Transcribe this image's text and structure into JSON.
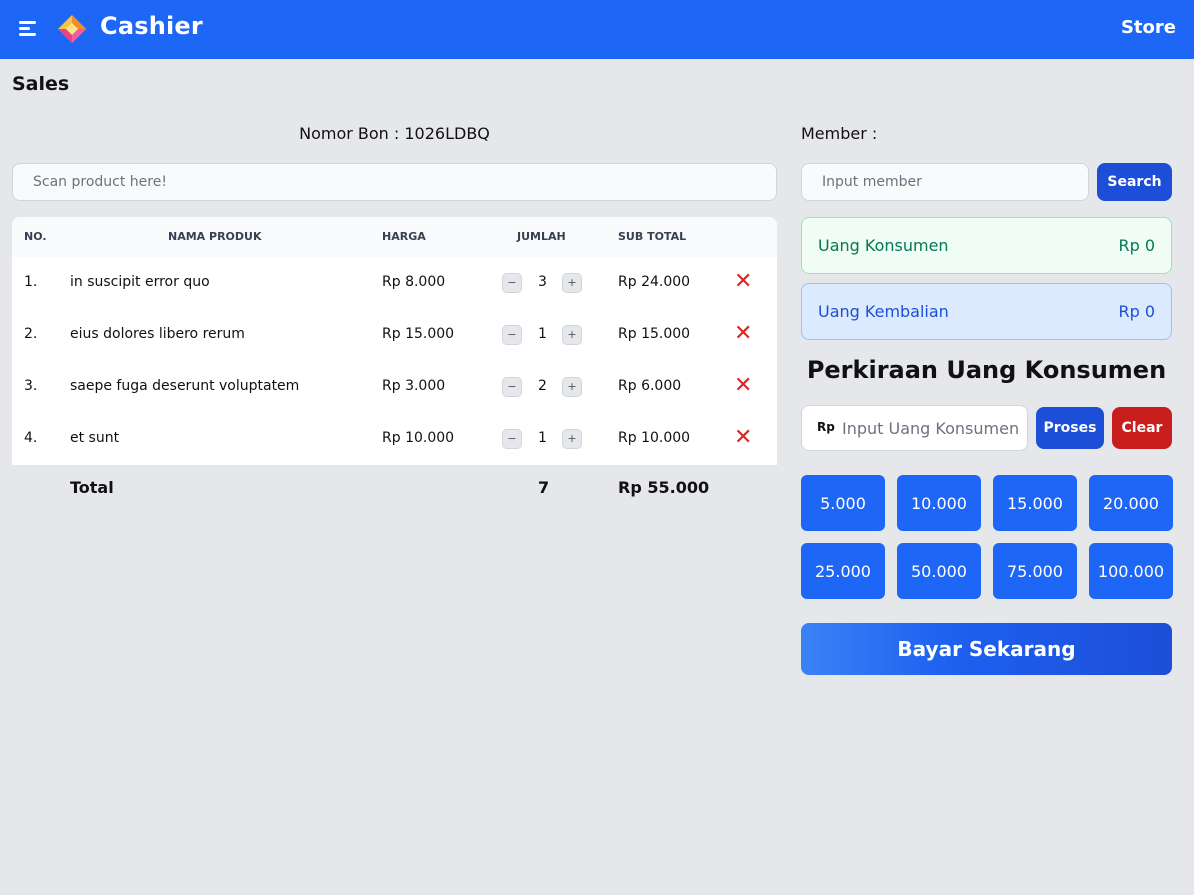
{
  "header": {
    "title": "Cashier",
    "store_label": "Store"
  },
  "page": {
    "title": "Sales"
  },
  "receipt": {
    "label": "Nomor Bon : 1026LDBQ"
  },
  "scan": {
    "placeholder": "Scan product here!"
  },
  "table": {
    "headers": {
      "no": "NO.",
      "name": "NAMA PRODUK",
      "price": "HARGA",
      "qty": "JUMLAH",
      "subtotal": "SUB TOTAL"
    },
    "rows": [
      {
        "no": "1.",
        "name": "in suscipit error quo",
        "price": "Rp 8.000",
        "qty": "3",
        "subtotal": "Rp 24.000"
      },
      {
        "no": "2.",
        "name": "eius dolores libero rerum",
        "price": "Rp 15.000",
        "qty": "1",
        "subtotal": "Rp 15.000"
      },
      {
        "no": "3.",
        "name": "saepe fuga deserunt voluptatem",
        "price": "Rp 3.000",
        "qty": "2",
        "subtotal": "Rp 6.000"
      },
      {
        "no": "4.",
        "name": "et sunt",
        "price": "Rp 10.000",
        "qty": "1",
        "subtotal": "Rp 10.000"
      }
    ],
    "total": {
      "label": "Total",
      "qty": "7",
      "amount": "Rp 55.000"
    }
  },
  "member": {
    "label": "Member :",
    "placeholder": "Input member",
    "search_label": "Search"
  },
  "uang_konsumen": {
    "label": "Uang Konsumen",
    "value": "Rp 0"
  },
  "uang_kembalian": {
    "label": "Uang Kembalian",
    "value": "Rp 0"
  },
  "estimate": {
    "title": "Perkiraan Uang Konsumen",
    "currency": "Rp",
    "placeholder": "Input Uang Konsumen",
    "proses_label": "Proses",
    "clear_label": "Clear",
    "denominations": [
      "5.000",
      "10.000",
      "15.000",
      "20.000",
      "25.000",
      "50.000",
      "75.000",
      "100.000"
    ]
  },
  "pay": {
    "label": "Bayar Sekarang"
  },
  "colors": {
    "primary": "#1e66f5",
    "danger": "#c81e1e",
    "success": "#047857"
  }
}
